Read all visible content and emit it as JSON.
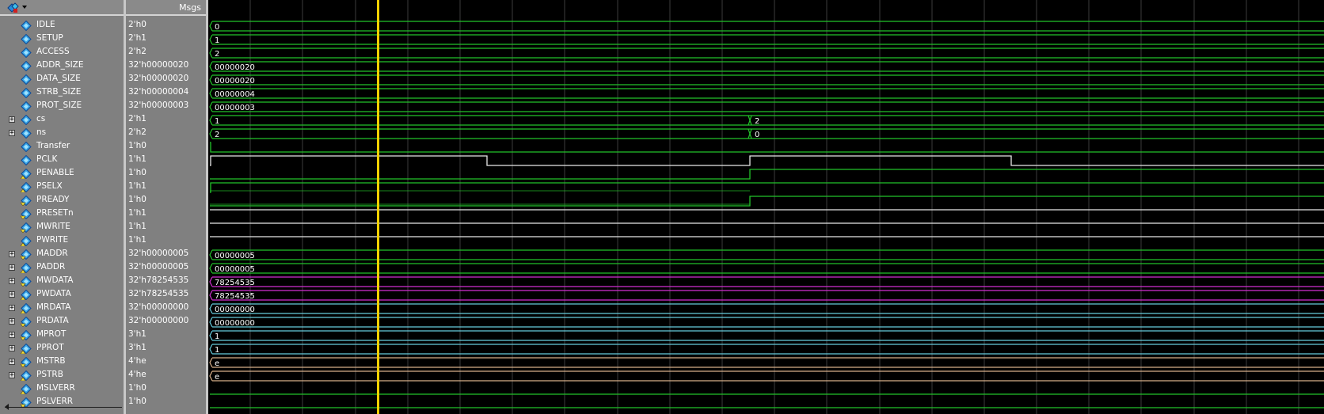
{
  "header": {
    "msgs_label": "Msgs",
    "toolbar_icon": "wave-format-icon"
  },
  "colors": {
    "panel_bg": "#808080",
    "wave_bg": "#000000",
    "grid": "#3c3c3c",
    "cursor": "#f0d000",
    "green": "#22c32a",
    "white": "#e8e8e8",
    "cyan": "#66ccdd",
    "magenta": "#d22fd2",
    "tan": "#d8b08a"
  },
  "signals": [
    {
      "name": "IDLE",
      "value": "2'h0",
      "icon": "parameter-icon",
      "expandable": false,
      "wave": {
        "kind": "bus",
        "color": "green",
        "labels": [
          "0"
        ]
      }
    },
    {
      "name": "SETUP",
      "value": "2'h1",
      "icon": "parameter-icon",
      "expandable": false,
      "wave": {
        "kind": "bus",
        "color": "green",
        "labels": [
          "1"
        ]
      }
    },
    {
      "name": "ACCESS",
      "value": "2'h2",
      "icon": "parameter-icon",
      "expandable": false,
      "wave": {
        "kind": "bus",
        "color": "green",
        "labels": [
          "2"
        ]
      }
    },
    {
      "name": "ADDR_SIZE",
      "value": "32'h00000020",
      "icon": "parameter-icon",
      "expandable": false,
      "wave": {
        "kind": "bus",
        "color": "green",
        "labels": [
          "00000020"
        ]
      }
    },
    {
      "name": "DATA_SIZE",
      "value": "32'h00000020",
      "icon": "parameter-icon",
      "expandable": false,
      "wave": {
        "kind": "bus",
        "color": "green",
        "labels": [
          "00000020"
        ]
      }
    },
    {
      "name": "STRB_SIZE",
      "value": "32'h00000004",
      "icon": "parameter-icon",
      "expandable": false,
      "wave": {
        "kind": "bus",
        "color": "green",
        "labels": [
          "00000004"
        ]
      }
    },
    {
      "name": "PROT_SIZE",
      "value": "32'h00000003",
      "icon": "parameter-icon",
      "expandable": false,
      "wave": {
        "kind": "bus",
        "color": "green",
        "labels": [
          "00000003"
        ]
      }
    },
    {
      "name": "cs",
      "value": "2'h1",
      "icon": "signal-icon",
      "expandable": true,
      "wave": {
        "kind": "bus",
        "color": "green",
        "labels": [
          "1",
          "2"
        ]
      }
    },
    {
      "name": "ns",
      "value": "2'h2",
      "icon": "signal-icon",
      "expandable": true,
      "wave": {
        "kind": "bus",
        "color": "green",
        "labels": [
          "2",
          "0"
        ]
      }
    },
    {
      "name": "Transfer",
      "value": "1'h0",
      "icon": "signal-icon",
      "expandable": false,
      "wave": {
        "kind": "bit",
        "color": "green"
      }
    },
    {
      "name": "PCLK",
      "value": "1'h1",
      "icon": "signal-icon",
      "expandable": false,
      "wave": {
        "kind": "bit",
        "color": "white"
      }
    },
    {
      "name": "PENABLE",
      "value": "1'h0",
      "icon": "output-icon",
      "expandable": false,
      "wave": {
        "kind": "bit",
        "color": "green"
      }
    },
    {
      "name": "PSELX",
      "value": "1'h1",
      "icon": "output-icon",
      "expandable": false,
      "wave": {
        "kind": "bit",
        "color": "green"
      }
    },
    {
      "name": "PREADY",
      "value": "1'h0",
      "icon": "input-icon",
      "expandable": false,
      "wave": {
        "kind": "bit",
        "color": "green"
      }
    },
    {
      "name": "PRESETn",
      "value": "1'h1",
      "icon": "input-icon",
      "expandable": false,
      "wave": {
        "kind": "bit",
        "color": "white"
      }
    },
    {
      "name": "MWRITE",
      "value": "1'h1",
      "icon": "input-icon",
      "expandable": false,
      "wave": {
        "kind": "bit",
        "color": "white"
      }
    },
    {
      "name": "PWRITE",
      "value": "1'h1",
      "icon": "output-icon",
      "expandable": false,
      "wave": {
        "kind": "bit",
        "color": "white"
      }
    },
    {
      "name": "MADDR",
      "value": "32'h00000005",
      "icon": "input-icon",
      "expandable": true,
      "wave": {
        "kind": "bus",
        "color": "green",
        "labels": [
          "00000005"
        ]
      }
    },
    {
      "name": "PADDR",
      "value": "32'h00000005",
      "icon": "output-icon",
      "expandable": true,
      "wave": {
        "kind": "bus",
        "color": "green",
        "labels": [
          "00000005"
        ]
      }
    },
    {
      "name": "MWDATA",
      "value": "32'h78254535",
      "icon": "input-icon",
      "expandable": true,
      "wave": {
        "kind": "bus",
        "color": "magenta",
        "labels": [
          "78254535"
        ]
      }
    },
    {
      "name": "PWDATA",
      "value": "32'h78254535",
      "icon": "output-icon",
      "expandable": true,
      "wave": {
        "kind": "bus",
        "color": "magenta",
        "labels": [
          "78254535"
        ]
      }
    },
    {
      "name": "MRDATA",
      "value": "32'h00000000",
      "icon": "output-icon",
      "expandable": true,
      "wave": {
        "kind": "bus",
        "color": "cyan",
        "labels": [
          "00000000"
        ]
      }
    },
    {
      "name": "PRDATA",
      "value": "32'h00000000",
      "icon": "input-icon",
      "expandable": true,
      "wave": {
        "kind": "bus",
        "color": "cyan",
        "labels": [
          "00000000"
        ]
      }
    },
    {
      "name": "MPROT",
      "value": "3'h1",
      "icon": "input-icon",
      "expandable": true,
      "wave": {
        "kind": "bus",
        "color": "cyan",
        "labels": [
          "1"
        ]
      }
    },
    {
      "name": "PPROT",
      "value": "3'h1",
      "icon": "output-icon",
      "expandable": true,
      "wave": {
        "kind": "bus",
        "color": "cyan",
        "labels": [
          "1"
        ]
      }
    },
    {
      "name": "MSTRB",
      "value": "4'he",
      "icon": "input-icon",
      "expandable": true,
      "wave": {
        "kind": "bus",
        "color": "tan",
        "labels": [
          "e"
        ]
      }
    },
    {
      "name": "PSTRB",
      "value": "4'he",
      "icon": "output-icon",
      "expandable": true,
      "wave": {
        "kind": "bus",
        "color": "tan",
        "labels": [
          "e"
        ]
      }
    },
    {
      "name": "MSLVERR",
      "value": "1'h0",
      "icon": "output-icon",
      "expandable": false,
      "wave": {
        "kind": "bit",
        "color": "green"
      }
    },
    {
      "name": "PSLVERR",
      "value": "1'h0",
      "icon": "input-icon",
      "expandable": false,
      "wave": {
        "kind": "bit",
        "color": "green"
      }
    }
  ]
}
